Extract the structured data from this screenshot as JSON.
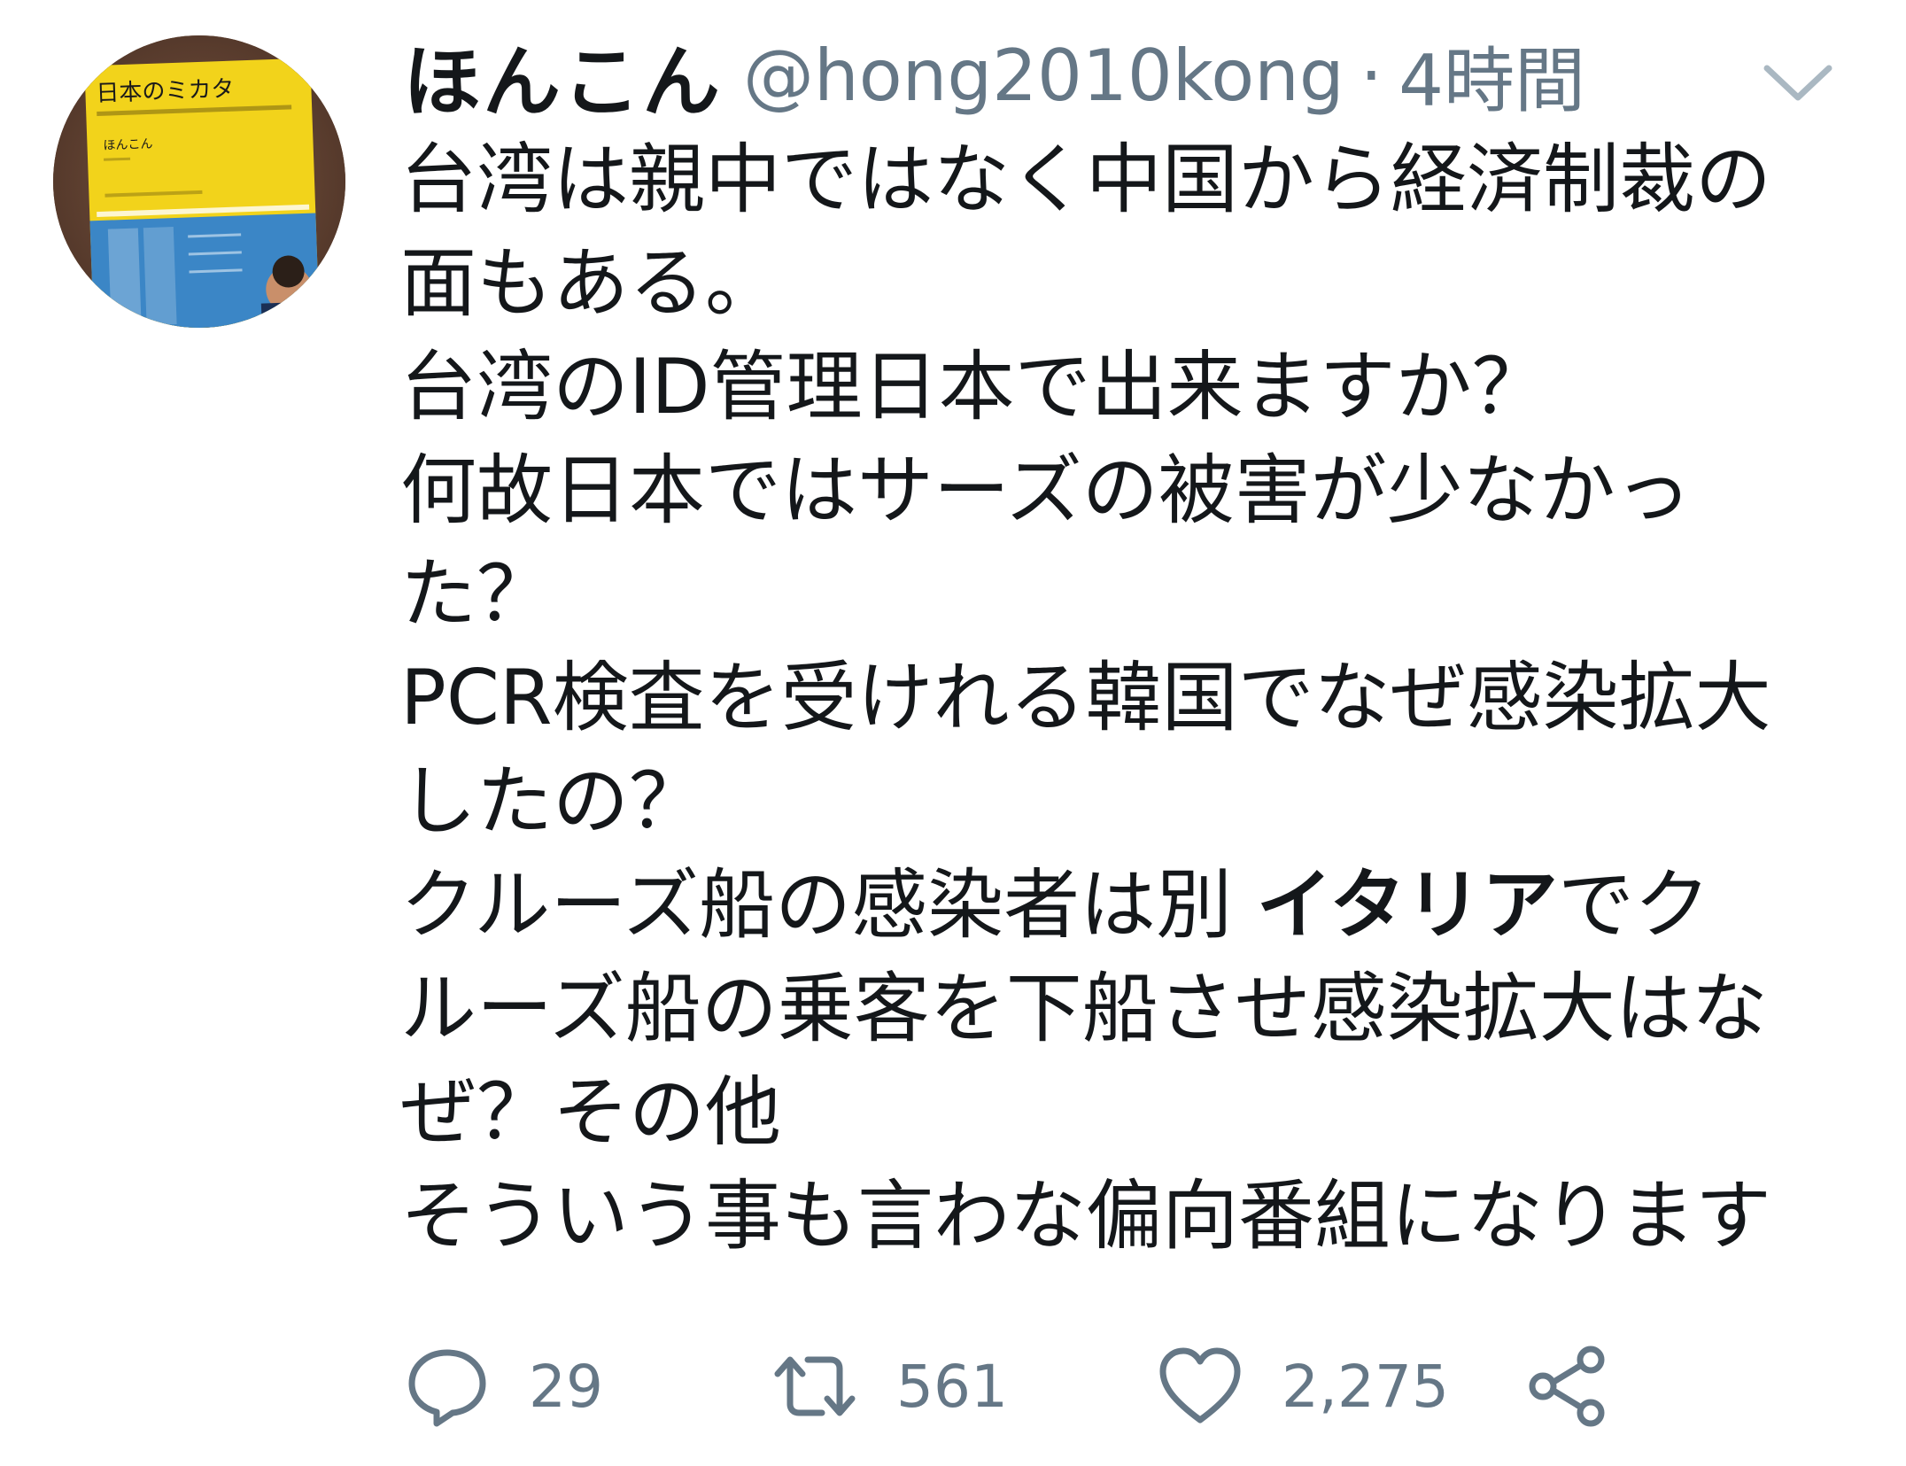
{
  "user": {
    "display_name": "ほんこん",
    "handle": "@hong2010kong",
    "separator": "·",
    "time": "4時間",
    "avatar": {
      "book_title": "日本のミカタ",
      "book_author": "ほんこん"
    }
  },
  "tweet": {
    "lines": [
      {
        "pre": "台湾は親中ではなく中国から経済制裁の",
        "hl": "",
        "post": ""
      },
      {
        "pre": "面もある。",
        "hl": "",
        "post": ""
      },
      {
        "pre": "台湾のID管理日本で出来ますか？",
        "hl": "",
        "post": ""
      },
      {
        "pre": "何故日本ではサーズの被害が少なかっ",
        "hl": "",
        "post": ""
      },
      {
        "pre": "た？",
        "hl": "",
        "post": ""
      },
      {
        "pre": "PCR検査を受けれる韓国でなぜ感染拡大",
        "hl": "",
        "post": ""
      },
      {
        "pre": "したの？",
        "hl": "",
        "post": ""
      },
      {
        "pre": "クルーズ船の感染者は別 ",
        "hl": "イタリア",
        "post": "でク"
      },
      {
        "pre": "ルーズ船の乗客を下船させ感染拡大はな",
        "hl": "",
        "post": ""
      },
      {
        "pre": "ぜ？その他",
        "hl": "",
        "post": ""
      },
      {
        "pre": "そういう事も言わな偏向番組になります",
        "hl": "",
        "post": ""
      }
    ]
  },
  "stats": {
    "replies": "29",
    "retweets": "561",
    "likes": "2,275"
  },
  "icons": {
    "caret": "chevron-down-icon",
    "reply": "reply-icon",
    "retweet": "retweet-icon",
    "like": "heart-icon",
    "share": "share-icon"
  },
  "colors": {
    "text": "#14171a",
    "secondary": "#657786",
    "avatar_book_yellow": "#f2d31b",
    "avatar_book_blue": "#3b86c6",
    "avatar_bg": "#6b4a37"
  }
}
